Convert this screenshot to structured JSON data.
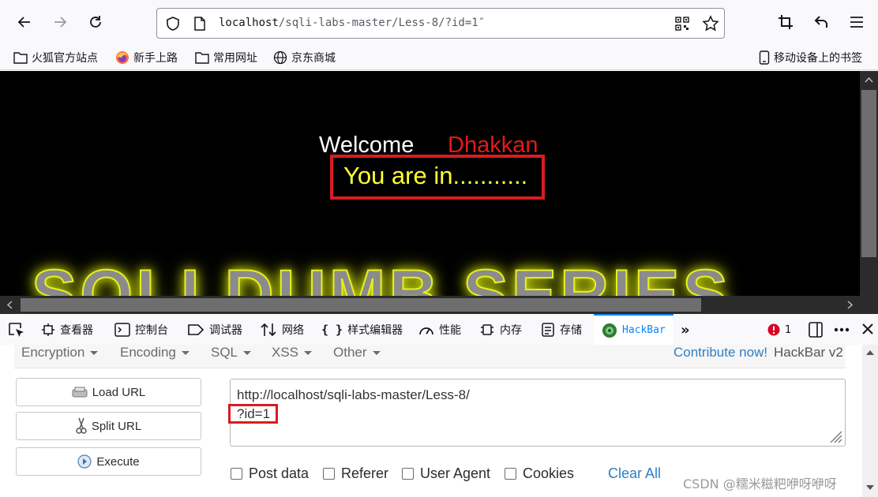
{
  "browser": {
    "url_host": "localhost",
    "url_path": "/sqli-labs-master/Less-8/?id=1″",
    "bookmarks": [
      {
        "label": "火狐官方站点",
        "icon": "folder-icon"
      },
      {
        "label": "新手上路",
        "icon": "firefox-icon"
      },
      {
        "label": "常用网址",
        "icon": "folder-icon"
      },
      {
        "label": "京东商城",
        "icon": "globe-icon"
      }
    ],
    "mobile_bookmarks": "移动设备上的书签"
  },
  "page": {
    "welcome": "Welcome",
    "user": "Dhakkan",
    "message": "You are in...........",
    "banner": "SQLI DUMB SERIES"
  },
  "devtools": {
    "tabs": [
      {
        "label": "查看器",
        "icon": "inspector-icon"
      },
      {
        "label": "控制台",
        "icon": "console-icon"
      },
      {
        "label": "调试器",
        "icon": "debugger-icon"
      },
      {
        "label": "网络",
        "icon": "network-icon"
      },
      {
        "label": "样式编辑器",
        "icon": "style-editor-icon"
      },
      {
        "label": "性能",
        "icon": "performance-icon"
      },
      {
        "label": "内存",
        "icon": "memory-icon"
      },
      {
        "label": "存储",
        "icon": "storage-icon"
      },
      {
        "label": "HackBar",
        "icon": "hackbar-icon"
      }
    ],
    "error_count": "1",
    "colors": {
      "active_tab": "#0a84ff",
      "error": "#d70022"
    }
  },
  "hackbar": {
    "menu": [
      "Encryption",
      "Encoding",
      "SQL",
      "XSS",
      "Other"
    ],
    "contribute_link": "Contribute now!",
    "version": "HackBar v2",
    "buttons": {
      "load": "Load URL",
      "split": "Split URL",
      "execute": "Execute"
    },
    "url_line1": "http://localhost/sqli-labs-master/Less-8/",
    "url_line2": "?id=1",
    "checkboxes": [
      "Post data",
      "Referer",
      "User Agent",
      "Cookies"
    ],
    "clear_all": "Clear All"
  },
  "watermark": "CSDN @糯米糍粑咿呀咿呀"
}
